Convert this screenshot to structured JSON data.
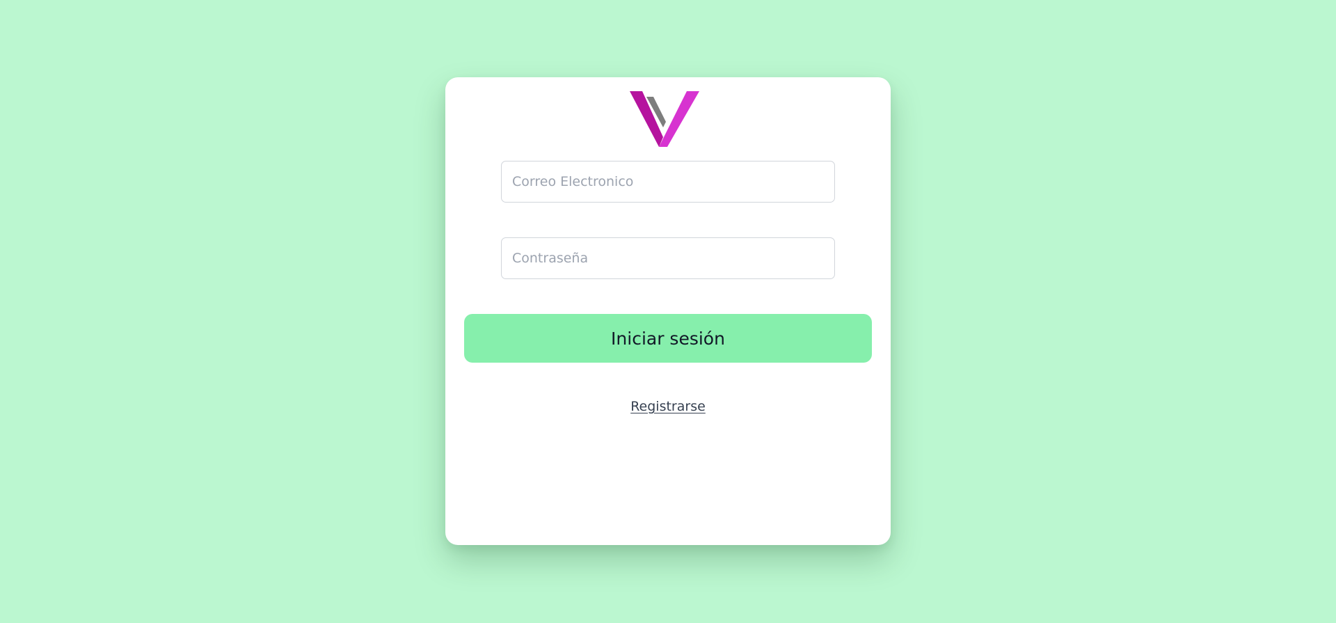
{
  "app": {
    "background_color": "#bbf7d0",
    "card_color": "#ffffff"
  },
  "logo": {
    "icon": "v-logo-icon",
    "colors": {
      "left_stroke": "#b5139e",
      "right_stroke": "#d733d0",
      "inner_stroke": "#7d7d7d"
    }
  },
  "form": {
    "email_placeholder": "Correo Electronico",
    "email_value": "",
    "password_placeholder": "Contraseña",
    "password_value": "",
    "login_label": "Iniciar sesión",
    "login_color": "#86efac",
    "register_label": "Registrarse"
  }
}
